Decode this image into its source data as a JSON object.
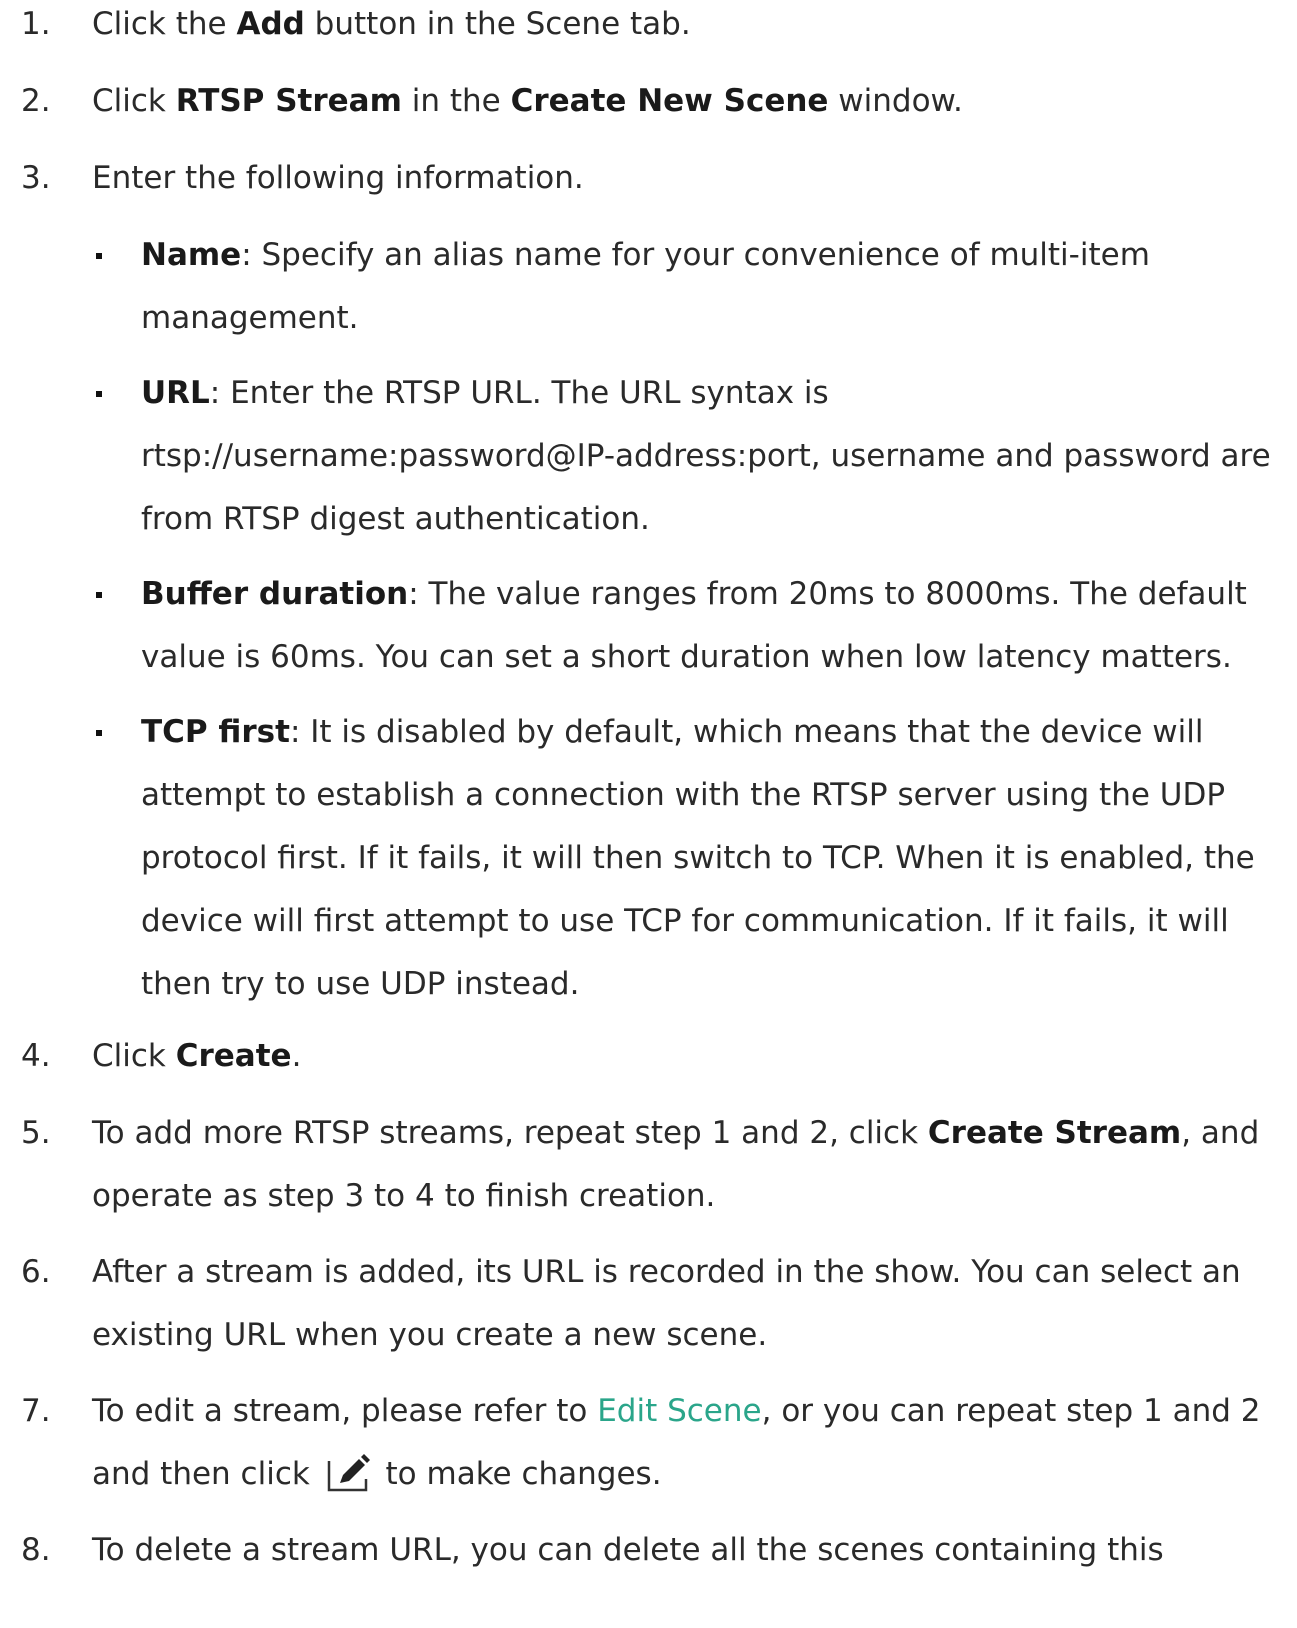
{
  "steps": [
    {
      "num": "1.",
      "pre": "Click the ",
      "b1": "Add",
      "post": " button in the Scene tab."
    },
    {
      "num": "2.",
      "pre": "Click ",
      "b1": "RTSP Stream",
      "mid": " in the ",
      "b2": "Create New Scene",
      "post": " window."
    },
    {
      "num": "3.",
      "text": "Enter the following information."
    },
    {
      "num": "4.",
      "pre": "Click ",
      "b1": "Create",
      "post": "."
    },
    {
      "num": "5.",
      "pre": "To add more RTSP streams, repeat step 1 and 2, click ",
      "b1": "Create Stream",
      "post": ", and operate as step 3 to 4 to finish creation."
    },
    {
      "num": "6.",
      "text": "After a stream is added, its URL is recorded in the show. You can select an existing URL when you create a new scene."
    },
    {
      "num": "7.",
      "pre": "To edit a stream, please refer to ",
      "link": "Edit Scene",
      "mid": ", or you can repeat step 1 and 2 and then click ",
      "post": " to make changes."
    },
    {
      "num": "8.",
      "text": "To delete a stream URL, you can delete all the scenes containing this"
    }
  ],
  "fields": [
    {
      "label": "Name",
      "desc": ": Specify an alias name for your convenience of multi-item management."
    },
    {
      "label": "URL",
      "desc": ": Enter the RTSP URL. The URL syntax is rtsp://username:password@IP-address:port, username and password are from RTSP digest authentication."
    },
    {
      "label": "Buffer duration",
      "desc": ": The value ranges from 20ms to 8000ms. The default value is 60ms. You can set a short duration when low latency matters."
    },
    {
      "label": "TCP first",
      "desc": ": It is disabled by default, which means that the device will attempt to establish a connection with the RTSP server using the UDP protocol first. If it fails, it will then switch to TCP. When it is enabled, the device will first attempt to use TCP for communication. If it fails, it will then try to use UDP instead."
    }
  ],
  "icons": {
    "edit": "edit-pencil-icon"
  }
}
